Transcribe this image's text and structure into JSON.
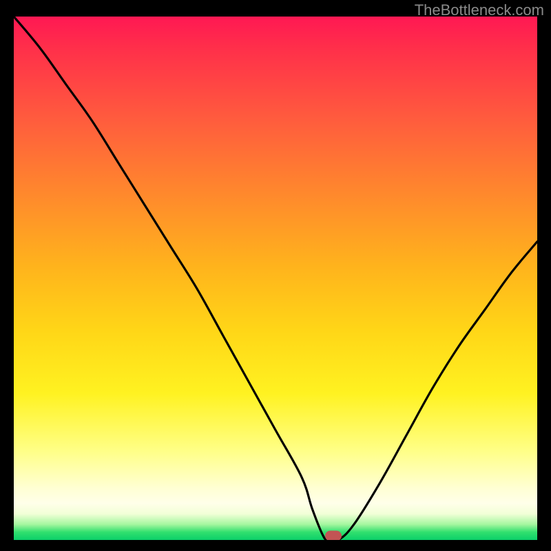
{
  "watermark": "TheBottleneck.com",
  "colors": {
    "background": "#000000",
    "curve": "#000000",
    "marker": "#c25454",
    "gradient_top": "#ff1853",
    "gradient_mid": "#ffd617",
    "gradient_bottom": "#0bcf69"
  },
  "chart_data": {
    "type": "line",
    "title": "",
    "xlabel": "",
    "ylabel": "",
    "xlim": [
      0,
      100
    ],
    "ylim": [
      0,
      100
    ],
    "x": [
      0,
      5,
      10,
      15,
      20,
      25,
      30,
      35,
      40,
      45,
      50,
      55,
      57,
      59,
      60,
      62,
      65,
      70,
      75,
      80,
      85,
      90,
      95,
      100
    ],
    "values": [
      100,
      94,
      87,
      80,
      72,
      64,
      56,
      48,
      39,
      30,
      21,
      12,
      6,
      1,
      0,
      0,
      3,
      11,
      20,
      29,
      37,
      44,
      51,
      57
    ],
    "marker": {
      "x": 61,
      "y": 0
    },
    "annotations": []
  }
}
